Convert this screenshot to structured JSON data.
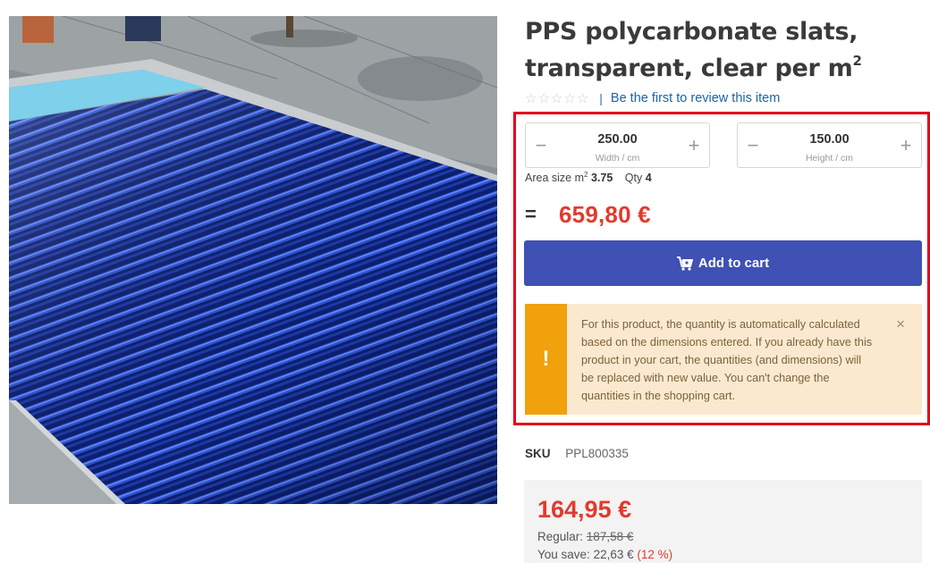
{
  "product": {
    "title": "PPS polycarbonate slats, transparent, clear per m",
    "title_superscript": "2",
    "image_alt": "Swimming pool covered with blue polycarbonate slats"
  },
  "rating": {
    "stars_filled": 0,
    "stars_total": 5,
    "separator": "|",
    "review_link": "Be the first to review this item"
  },
  "dimensions": {
    "width": {
      "value": "250.00",
      "unit_label": "Width / cm"
    },
    "height": {
      "value": "150.00",
      "unit_label": "Height / cm"
    },
    "minus_icon": "−",
    "plus_icon": "+"
  },
  "area": {
    "label": "Area size m",
    "label_superscript": "2",
    "value": "3.75",
    "qty_label": "Qty",
    "qty_value": "4"
  },
  "total": {
    "equals": "=",
    "price": "659,80 €"
  },
  "cart_button": {
    "label": "Add to cart",
    "icon": "cart-plus-icon"
  },
  "alert": {
    "icon": "!",
    "message": "For this product, the quantity is automatically calculated based on the dimensions entered. If you already have this product in your cart, the quantities (and dimensions) will be replaced with new value. You can't change the quantities in the shopping cart.",
    "close": "×"
  },
  "sku": {
    "label": "SKU",
    "value": "PPL800335"
  },
  "pricing": {
    "sale_price": "164,95 €",
    "regular_label": "Regular:",
    "regular_price": "187,58 €",
    "save_label": "You save:",
    "save_amount": "22,63 €",
    "save_percent": "(12 %)"
  },
  "colors": {
    "accent_blue": "#3f51b5",
    "price_red": "#e23a2d",
    "highlight_red": "#e3001b",
    "alert_orange": "#f0a10b",
    "alert_bg": "#fbe9cf"
  }
}
